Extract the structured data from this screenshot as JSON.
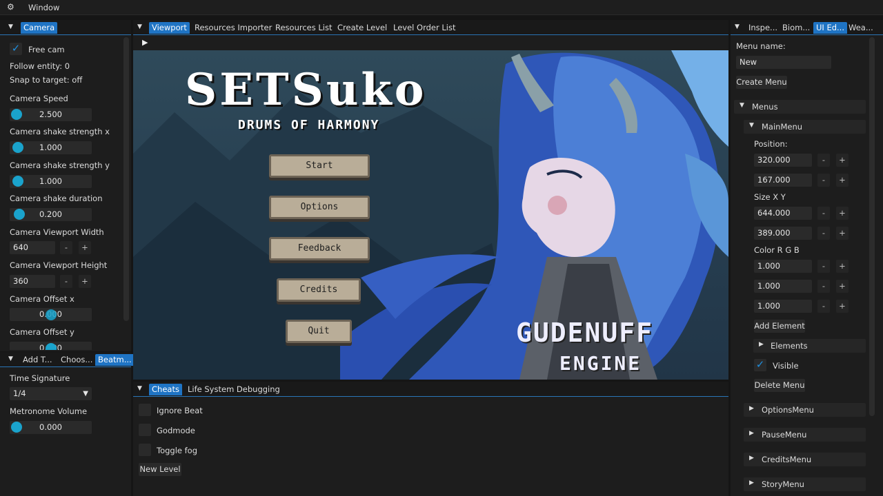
{
  "window": {
    "title": "Window"
  },
  "left_panel": {
    "tab": "Camera",
    "free_cam_label": "Free cam",
    "follow_entity": "Follow entity: 0",
    "snap_to_target": "Snap to target: off",
    "fields": [
      {
        "label": "Camera Speed",
        "value": "2.500"
      },
      {
        "label": "Camera shake strength x",
        "value": "1.000"
      },
      {
        "label": "Camera shake strength y",
        "value": "1.000"
      },
      {
        "label": "Camera shake duration",
        "value": "0.200"
      }
    ],
    "viewport_width_label": "Camera Viewport Width",
    "viewport_width_value": "640",
    "viewport_height_label": "Camera Viewport Height",
    "viewport_height_value": "360",
    "offset_x_label": "Camera Offset x",
    "offset_x_value": "0.000",
    "offset_y_label": "Camera Offset y",
    "offset_y_value": "0.000",
    "minus": "-",
    "plus": "+"
  },
  "left_bottom": {
    "tabs": [
      "Add T...",
      "Choos...",
      "Beatm..."
    ],
    "time_signature_label": "Time Signature",
    "time_signature_value": "1/4",
    "metronome_label": "Metronome Volume",
    "metronome_value": "0.000"
  },
  "center_tabs": [
    "Viewport",
    "Resources Importer",
    "Resources List",
    "Create Level",
    "Level Order List"
  ],
  "scene": {
    "title": "SETSuko",
    "subtitle": "DRUMS OF HARMONY",
    "buttons": [
      "Start",
      "Options",
      "Feedback",
      "Credits",
      "Quit"
    ],
    "engine_line1": "GUDENUFF",
    "engine_line2": "ENGINE"
  },
  "bottom_panel": {
    "tabs": [
      "Cheats",
      "Life System Debugging"
    ],
    "checks": [
      "Ignore Beat",
      "Godmode",
      "Toggle fog"
    ],
    "new_level": "New Level"
  },
  "right_panel": {
    "tabs": [
      "Inspe...",
      "Biom...",
      "UI Ed...",
      "Wea..."
    ],
    "menu_name_label": "Menu name:",
    "menu_name_value": "New",
    "create_menu": "Create Menu",
    "menus_header": "Menus",
    "main_menu": "MainMenu",
    "position_label": "Position:",
    "position": [
      "320.000",
      "167.000"
    ],
    "size_label": "Size X Y",
    "size": [
      "644.000",
      "389.000"
    ],
    "color_label": "Color R G B",
    "color": [
      "1.000",
      "1.000",
      "1.000"
    ],
    "add_element": "Add Element",
    "elements": "Elements",
    "visible": "Visible",
    "delete_menu": "Delete Menu",
    "other_menus": [
      "OptionsMenu",
      "PauseMenu",
      "CreditsMenu",
      "StoryMenu"
    ],
    "minus": "-",
    "plus": "+"
  },
  "colors": {
    "accent": "#1f74c4",
    "knob": "#1aa3cc",
    "panel": "#1d1d1d"
  }
}
